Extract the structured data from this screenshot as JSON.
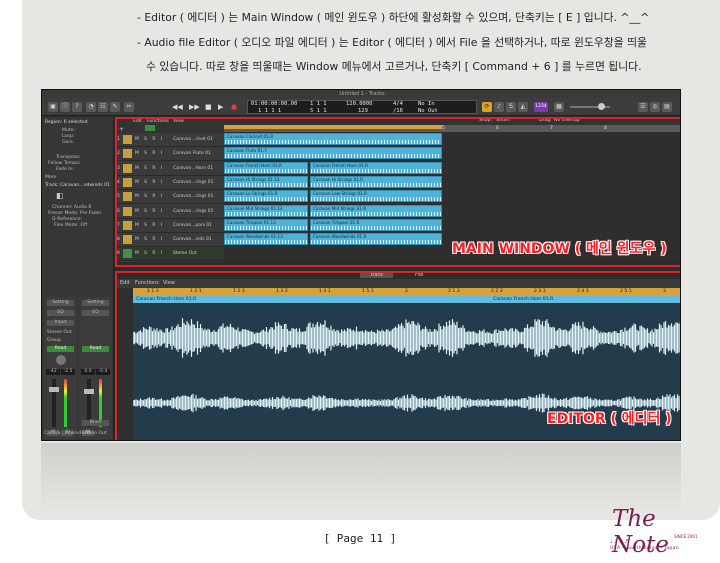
{
  "intro": {
    "line1": "- Editor ( 에디터 ) 는 Main Window ( 메인 윈도우 ) 하단에 활성화할 수 있으며, 단축키는 [ E ] 입니다. ^__^",
    "line2": "- Audio file Editor ( 오디오 파일 에디터 ) 는 Editor ( 에디터 ) 에서 File 을 선택하거나, 따로 윈도우창을 띄울",
    "line3": "수 있습니다. 따로 창을 띄울때는 Window 메뉴에서 고르거나, 단축키 [ Command + 6 ] 를 누르면 됩니다."
  },
  "app": {
    "window_title": "Untitled 1 - Tracks",
    "lcd": {
      "time": "01:00:00:00.00",
      "sub_time": "1 1 1 1",
      "bar": "1 1 1",
      "beat": "5 1 1",
      "tempo": "120.0000",
      "tempo_keep": "129",
      "sig": "4/4",
      "div": "/16",
      "in": "No In",
      "out": "No Out"
    },
    "cpu_badge": "1234",
    "inspector": {
      "region_label": "Region: 6 selected",
      "mute": "Mute:",
      "loop": "Loop:",
      "gain": "Gain:",
      "transpose": "Transpose:",
      "follow_tempo": "Follow Tempo:",
      "fade_in": "Fade In:",
      "more": "More",
      "track_label": "Track: Caravan...ndwinds 01",
      "channel": "Channel: Audio 8",
      "freeze_mode": "Freeze Mode: Pre Fader",
      "q_reference": "Q-Reference:",
      "flex_mode": "Flex Mode: Off",
      "setting1": "Setting",
      "setting2": "Setting",
      "eq1": "EQ",
      "eq2": "EQ",
      "input": "Input",
      "stereo_out": "Stereo Out",
      "group": "Group",
      "read1": "Read",
      "read2": "Read",
      "val1": "-42",
      "val2": "-2.5",
      "val3": "0.0",
      "val4": "-0.4",
      "bnce": "Bnce",
      "m": "M",
      "s": "S",
      "strip1_name": "Carava...ndwinds 01",
      "strip2_name": "Stereo Out"
    },
    "tracks_toolbar": {
      "edit": "Edit",
      "functions": "Functions",
      "view": "View",
      "snap": "Snap:",
      "snap_val": "Smart",
      "drag": "Drag:",
      "drag_val": "No Overlap"
    },
    "ruler": [
      "1",
      "2",
      "3",
      "4",
      "5",
      "6",
      "7",
      "8"
    ],
    "tracks": [
      {
        "num": "1",
        "name": "Caravan...rinet 01",
        "color": "#c8a03a"
      },
      {
        "num": "2",
        "name": "Caravan Flute 01",
        "color": "#c8a03a"
      },
      {
        "num": "3",
        "name": "Caravan...Horn 01",
        "color": "#c8a03a"
      },
      {
        "num": "4",
        "name": "Caravan...rings 01",
        "color": "#c8a03a"
      },
      {
        "num": "5",
        "name": "Caravan...rings 01",
        "color": "#c8a03a"
      },
      {
        "num": "6",
        "name": "Caravan...rings 01",
        "color": "#c8a03a"
      },
      {
        "num": "7",
        "name": "Caravan...pani 01",
        "color": "#c8a03a"
      },
      {
        "num": "8",
        "name": "Caravan...inds 01",
        "color": "#c8a03a"
      },
      {
        "num": "9",
        "name": "Stereo Out",
        "color": "#4a8d4a"
      }
    ],
    "regions_a": [
      "Caravan Clarinet 01.R",
      "Caravan Flute 01.7",
      "Caravan French Horn 01.R",
      "Caravan Hi Strings 01.13",
      "Caravan Lo Strings 01.R",
      "Caravan Mid Strings 01.13",
      "Caravan Timpani 01.13",
      "Caravan Woodwinds 01.13"
    ],
    "regions_b": [
      "Caravan French Horn 01.R",
      "Caravan Hi Strings 01.R",
      "Caravan Low Strings 01.R",
      "Caravan Mid Strings 01.R",
      "Caravan Timpani 01.R",
      "Caravan Woodwinds 01.R"
    ],
    "editor": {
      "tab_track": "Track",
      "tab_file": "File",
      "edit": "Edit",
      "functions": "Functions",
      "view": "View",
      "ruler": [
        "1 1 3",
        "1 2 1",
        "1 2 3",
        "1 3 3",
        "1 4 1",
        "1 5 3",
        "2",
        "2 1 3",
        "2 2 3",
        "2 3 3",
        "2 4 3",
        "2 5 1",
        "3"
      ],
      "region1": "Caravan French Horn 01.R",
      "region2": "Caravan French Horn 01.R"
    }
  },
  "labels": {
    "main_window": "MAIN WINDOW ( 메인 윈도우 )",
    "editor": "EDITOR ( 에디터 )"
  },
  "footer": {
    "page": "[ Page 11 ]"
  },
  "logo": {
    "title": "The Note",
    "since": "SINCE 2001",
    "note_glyphs": "♩ ♪ ♫ ♬",
    "countries": "USA • South Korea • Japan"
  }
}
